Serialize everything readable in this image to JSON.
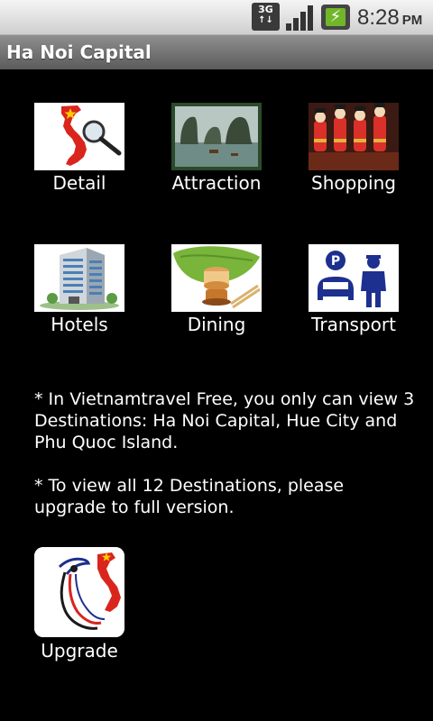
{
  "status_bar": {
    "network": "3G",
    "time": "8:28",
    "ampm": "PM"
  },
  "title_bar": {
    "title": "Ha Noi Capital"
  },
  "menu": [
    {
      "label": "Detail"
    },
    {
      "label": "Attraction"
    },
    {
      "label": "Shopping"
    },
    {
      "label": "Hotels"
    },
    {
      "label": "Dining"
    },
    {
      "label": "Transport"
    }
  ],
  "notes": {
    "free_limit": "* In Vietnamtravel Free, you only can view 3 Destinations: Ha Noi Capital, Hue City and Phu Quoc Island.",
    "upgrade_hint": "* To view all 12 Destinations, please upgrade to full version."
  },
  "upgrade": {
    "label": "Upgrade"
  },
  "colors": {
    "background": "#000000",
    "titlebar": "#6e6e6e",
    "statusbar": "#e0e0e0",
    "flag_red": "#da251d",
    "flag_yellow": "#ffcd00",
    "transport_blue": "#1d2f8f"
  }
}
